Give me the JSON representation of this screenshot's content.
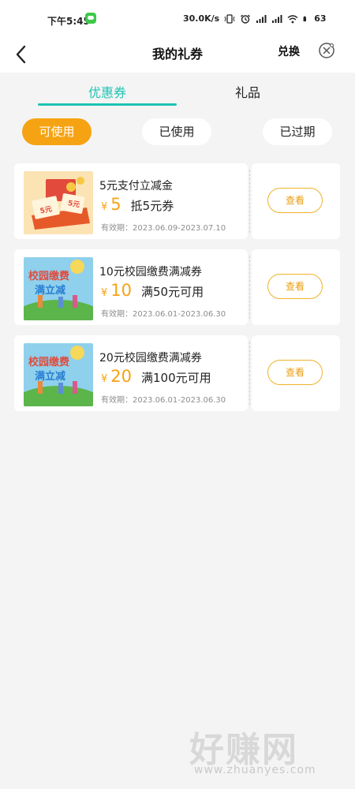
{
  "status_bar": {
    "time": "下午5:45",
    "network_speed": "30.0K/s",
    "battery": "63"
  },
  "header": {
    "title": "我的礼券",
    "exchange_label": "兑换",
    "back_icon": "chevron-left-icon",
    "close_icon": "close-circle-icon"
  },
  "tabs": [
    {
      "label": "优惠券",
      "active": true
    },
    {
      "label": "礼品",
      "active": false
    }
  ],
  "filters": [
    {
      "label": "可使用",
      "active": true
    },
    {
      "label": "已使用",
      "active": false
    },
    {
      "label": "已过期",
      "active": false
    }
  ],
  "coupons": [
    {
      "title": "5元支付立减金",
      "currency": "¥",
      "amount": "5",
      "description": "抵5元券",
      "validity": "有效期：2023.06.09-2023.07.10",
      "button_label": "查看",
      "thumb_text_1": "5元",
      "thumb_text_2": "5元"
    },
    {
      "title": "10元校园缴费满减券",
      "currency": "¥",
      "amount": "10",
      "description": "满50元可用",
      "validity": "有效期：2023.06.01-2023.06.30",
      "button_label": "查看",
      "thumb_text_1": "校园缴费",
      "thumb_text_2": "满立减"
    },
    {
      "title": "20元校园缴费满减券",
      "currency": "¥",
      "amount": "20",
      "description": "满100元可用",
      "validity": "有效期：2023.06.01-2023.06.30",
      "button_label": "查看",
      "thumb_text_1": "校园缴费",
      "thumb_text_2": "满立减"
    }
  ],
  "watermark": {
    "title": "好赚网",
    "url": "www.zhuanyes.com"
  },
  "colors": {
    "accent_teal": "#1ec4b3",
    "accent_orange": "#f6a313",
    "background": "#f4f4f4"
  }
}
